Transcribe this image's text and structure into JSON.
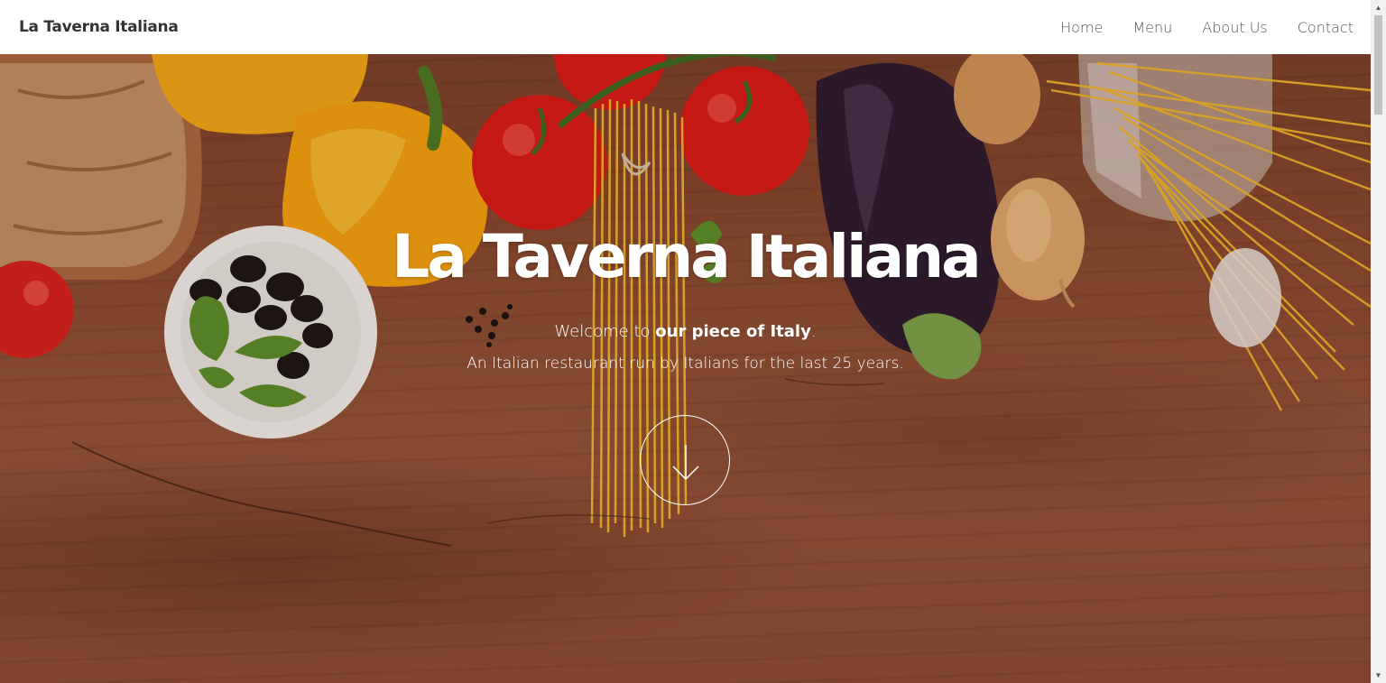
{
  "navbar": {
    "brand": "La Taverna Italiana",
    "links": [
      "Home",
      "Menu",
      "About Us",
      "Contact"
    ]
  },
  "hero": {
    "title": "La Taverna Italiana",
    "welcome_prefix": "Welcome to ",
    "welcome_bold": "our piece of Italy",
    "welcome_suffix": ".",
    "tagline": "An Italian restaurant run by Italians for the last 25 years."
  },
  "icons": {
    "scroll_down": "arrow-down-icon",
    "scrollbar_up": "triangle-up-icon",
    "scrollbar_down": "triangle-down-icon"
  },
  "colors": {
    "navbar_bg": "#ffffff",
    "brand_text": "#333333",
    "nav_text": "#555555",
    "hero_text": "#ffffff",
    "wood": "#8a4a30"
  }
}
